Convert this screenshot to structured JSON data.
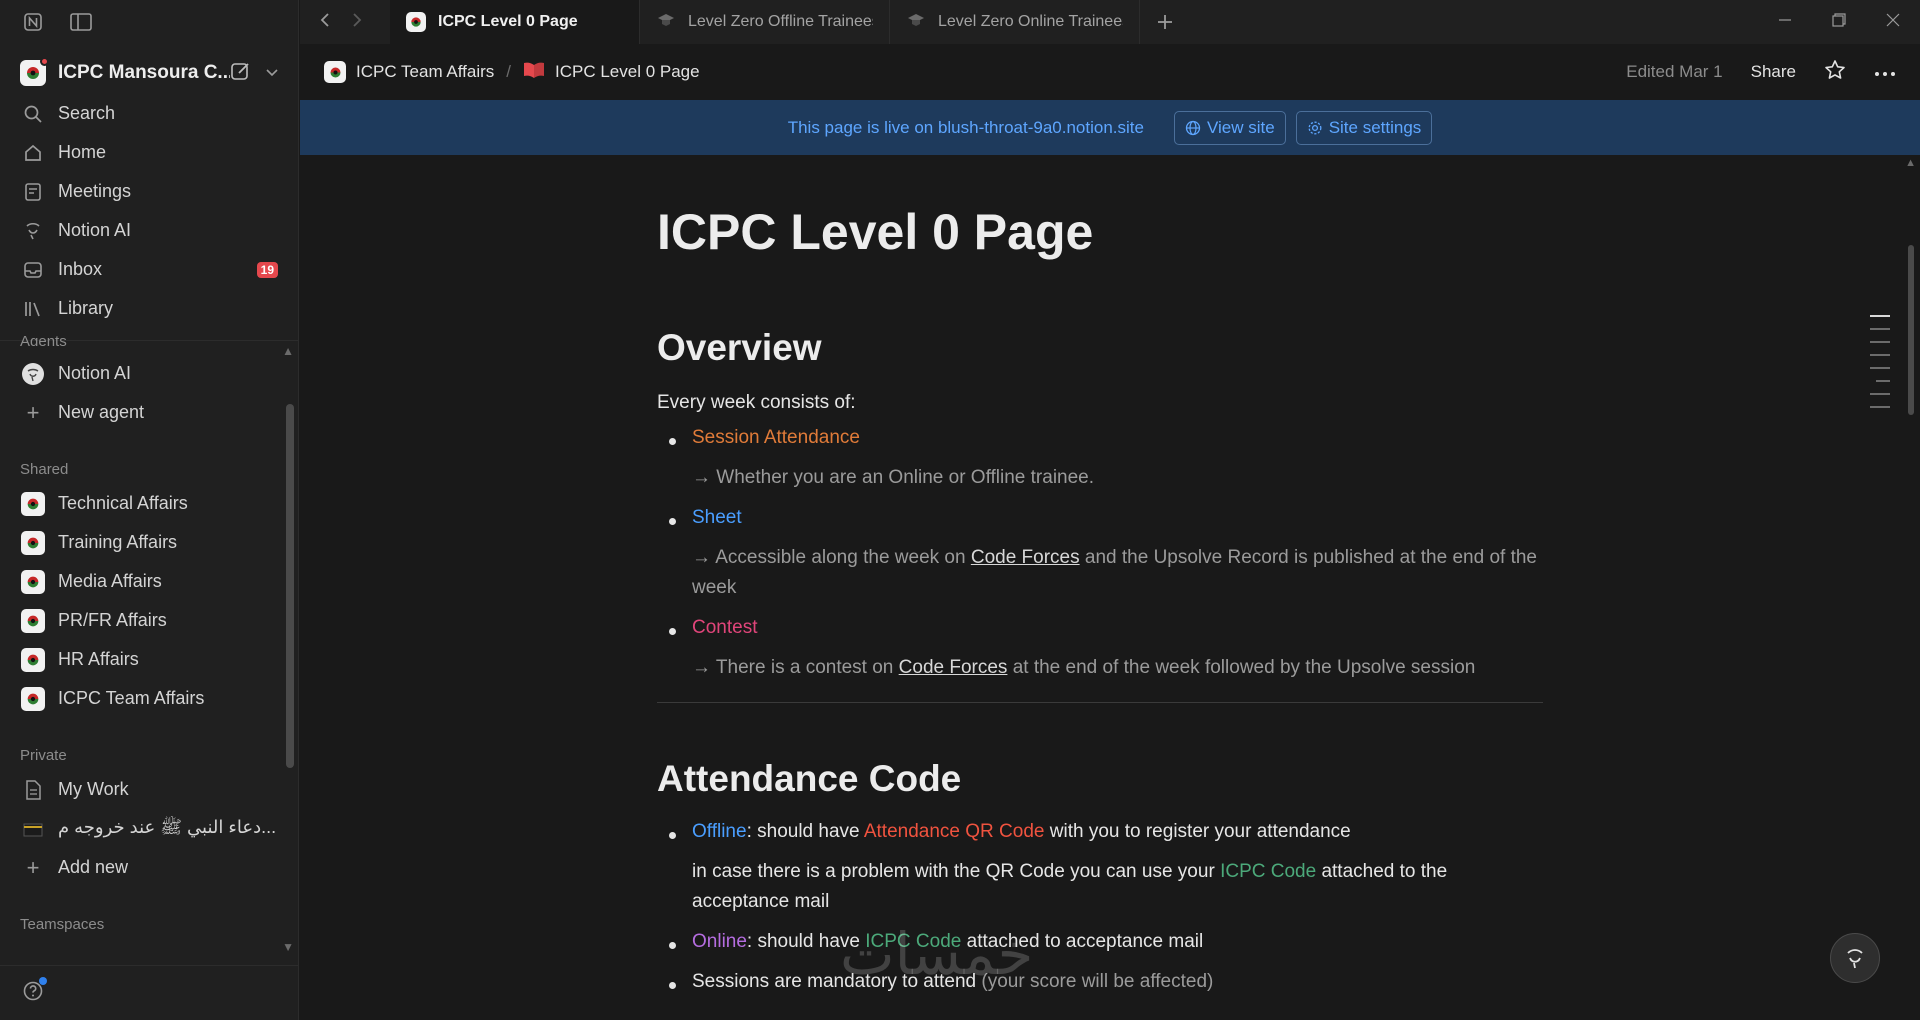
{
  "sidebar": {
    "workspace_name": "ICPC Mansoura C...",
    "nav": [
      {
        "label": "Search",
        "icon": "search-icon"
      },
      {
        "label": "Home",
        "icon": "home-icon"
      },
      {
        "label": "Meetings",
        "icon": "meetings-icon"
      },
      {
        "label": "Notion AI",
        "icon": "notion-ai-icon"
      },
      {
        "label": "Inbox",
        "icon": "inbox-icon",
        "badge": "19"
      },
      {
        "label": "Library",
        "icon": "library-icon"
      }
    ],
    "agents_title": "Agents",
    "agents": [
      {
        "label": "Notion AI"
      },
      {
        "label": "New agent"
      }
    ],
    "shared_title": "Shared",
    "shared": [
      {
        "label": "Technical Affairs"
      },
      {
        "label": "Training Affairs"
      },
      {
        "label": "Media Affairs"
      },
      {
        "label": "PR/FR Affairs"
      },
      {
        "label": "HR Affairs"
      },
      {
        "label": "ICPC Team Affairs"
      }
    ],
    "private_title": "Private",
    "private": [
      {
        "label": "My Work"
      },
      {
        "label": "دعاء النبي ﷺ عند خروجه م..."
      },
      {
        "label": "Add new"
      }
    ],
    "teamspaces_title": "Teamspaces"
  },
  "tabs": [
    {
      "label": "ICPC Level 0 Page",
      "active": true
    },
    {
      "label": "Level Zero Offline Trainees",
      "active": false
    },
    {
      "label": "Level Zero Online Trainees",
      "active": false
    }
  ],
  "header": {
    "breadcrumb": [
      "ICPC Team Affairs",
      "ICPC Level 0 Page"
    ],
    "edited": "Edited Mar 1",
    "share": "Share"
  },
  "banner": {
    "text": "This page is live on blush-throat-9a0.notion.site",
    "view_site": "View site",
    "site_settings": "Site settings"
  },
  "page": {
    "title": "ICPC Level 0 Page",
    "overview": {
      "heading": "Overview",
      "intro": "Every week consists of:",
      "items": [
        {
          "label": "Session Attendance",
          "detail": "→ Whether you are an Online or Offline trainee."
        },
        {
          "label": "Sheet",
          "detail_a": "→  Accessible along the week on ",
          "link": "Code Forces",
          "detail_b": " and the Upsolve Record is published at the end of the week"
        },
        {
          "label": "Contest",
          "detail_a": "→ There is a contest on ",
          "link": "Code Forces",
          "detail_b": " at the end of the week followed by the Upsolve session"
        }
      ]
    },
    "attendance": {
      "heading": "Attendance Code",
      "offline_label": "Offline",
      "offline_a": ": should have ",
      "offline_code": "Attendance QR Code",
      "offline_b": " with you to register your attendance",
      "offline_note_a": "in case there is a problem with the QR Code you can use your ",
      "offline_note_code": "ICPC Code",
      "offline_note_b": " attached to the acceptance mail",
      "online_label": "Online",
      "online_a": ": should have ",
      "online_code": "ICPC Code",
      "online_b": " attached to acceptance mail",
      "sessions_a": "Sessions are mandatory to attend ",
      "sessions_b": "(your score will be affected)"
    }
  },
  "watermark": "خمسات",
  "colors": {
    "accent_blue": "#4a9eff",
    "orange": "#e07b39",
    "pink": "#e0457a",
    "red": "#f0533f",
    "green": "#4ca97a",
    "purple": "#b56de0",
    "badge": "#e5484d"
  }
}
